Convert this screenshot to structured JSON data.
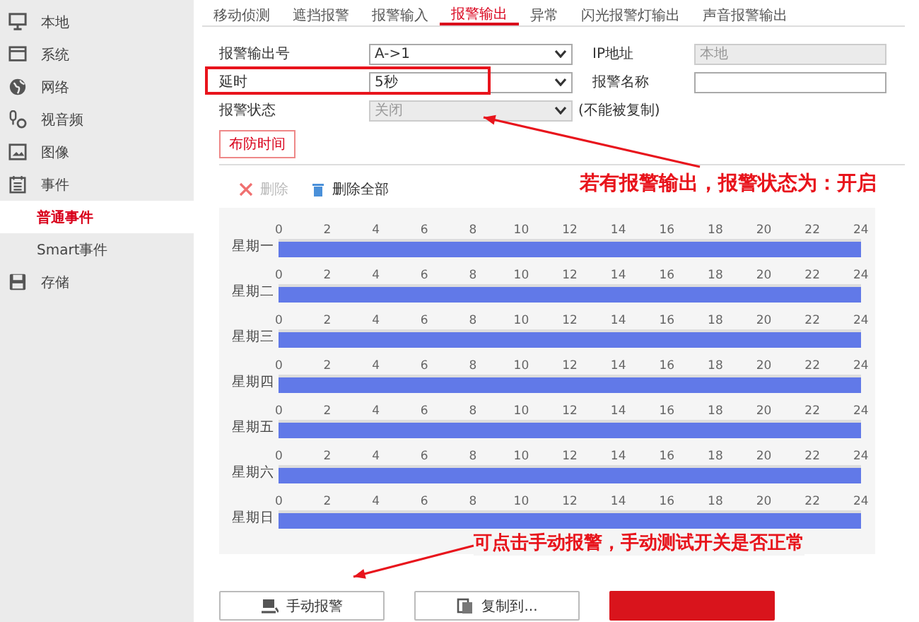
{
  "sidebar": {
    "items": [
      {
        "label": "本地",
        "selected": false
      },
      {
        "label": "系统",
        "selected": false
      },
      {
        "label": "网络",
        "selected": false
      },
      {
        "label": "视音频",
        "selected": false
      },
      {
        "label": "图像",
        "selected": false
      },
      {
        "label": "事件",
        "selected": false,
        "children": [
          {
            "label": "普通事件",
            "selected": true
          },
          {
            "label": "Smart事件",
            "selected": false
          }
        ]
      },
      {
        "label": "存储",
        "selected": false
      }
    ]
  },
  "tabs": [
    {
      "label": "移动侦测",
      "selected": false
    },
    {
      "label": "遮挡报警",
      "selected": false
    },
    {
      "label": "报警输入",
      "selected": false
    },
    {
      "label": "报警输出",
      "selected": true
    },
    {
      "label": "异常",
      "selected": false
    },
    {
      "label": "闪光报警灯输出",
      "selected": false
    },
    {
      "label": "声音报警输出",
      "selected": false
    }
  ],
  "form": [
    {
      "label": "报警输出号",
      "value": "A->1",
      "disabled": false,
      "highlighted": false,
      "side": {
        "label": "IP地址",
        "value": "本地",
        "disabled": true
      }
    },
    {
      "label": "延时",
      "value": "5秒",
      "disabled": false,
      "highlighted": true,
      "side": {
        "label": "报警名称",
        "disabled": false
      }
    },
    {
      "label": "报警状态",
      "value": "关闭",
      "disabled": true,
      "highlighted": false,
      "note": "(不能被复制)"
    }
  ],
  "schedule_tab": "布防时间",
  "toolbar": [
    {
      "kind": "delete",
      "label": "删除",
      "disabled": true
    },
    {
      "kind": "delete_all",
      "label": "删除全部",
      "disabled": false
    }
  ],
  "days": [
    {
      "label": "星期一",
      "level": 1,
      "ticks": [
        "0",
        "2",
        "4",
        "6",
        "8",
        "10",
        "12",
        "14",
        "16",
        "18",
        "20",
        "22",
        "24"
      ]
    },
    {
      "label": "星期二",
      "level": 1,
      "ticks": [
        "0",
        "2",
        "4",
        "6",
        "8",
        "10",
        "12",
        "14",
        "16",
        "18",
        "20",
        "22",
        "24"
      ]
    },
    {
      "label": "星期三",
      "level": 1,
      "ticks": [
        "0",
        "2",
        "4",
        "6",
        "8",
        "10",
        "12",
        "14",
        "16",
        "18",
        "20",
        "22",
        "24"
      ]
    },
    {
      "label": "星期四",
      "level": 1,
      "ticks": [
        "0",
        "2",
        "4",
        "6",
        "8",
        "10",
        "12",
        "14",
        "16",
        "18",
        "20",
        "22",
        "24"
      ]
    },
    {
      "label": "星期五",
      "level": 1,
      "ticks": [
        "0",
        "2",
        "4",
        "6",
        "8",
        "10",
        "12",
        "14",
        "16",
        "18",
        "20",
        "22",
        "24"
      ]
    },
    {
      "label": "星期六",
      "level": 1,
      "ticks": [
        "0",
        "2",
        "4",
        "6",
        "8",
        "10",
        "12",
        "14",
        "16",
        "18",
        "20",
        "22",
        "24"
      ]
    },
    {
      "label": "星期日",
      "level": 1,
      "ticks": [
        "0",
        "2",
        "4",
        "6",
        "8",
        "10",
        "12",
        "14",
        "16",
        "18",
        "20",
        "22",
        "24"
      ]
    }
  ],
  "buttons": [
    {
      "kind": "manual",
      "label": "手动报警"
    },
    {
      "kind": "copy",
      "label": "复制到..."
    },
    {
      "kind": "save"
    }
  ],
  "annotations": [
    {
      "text": "若有报警输出，报警状态为：开启"
    },
    {
      "text": "可点击手动报警，手动测试开关是否正常"
    }
  ]
}
